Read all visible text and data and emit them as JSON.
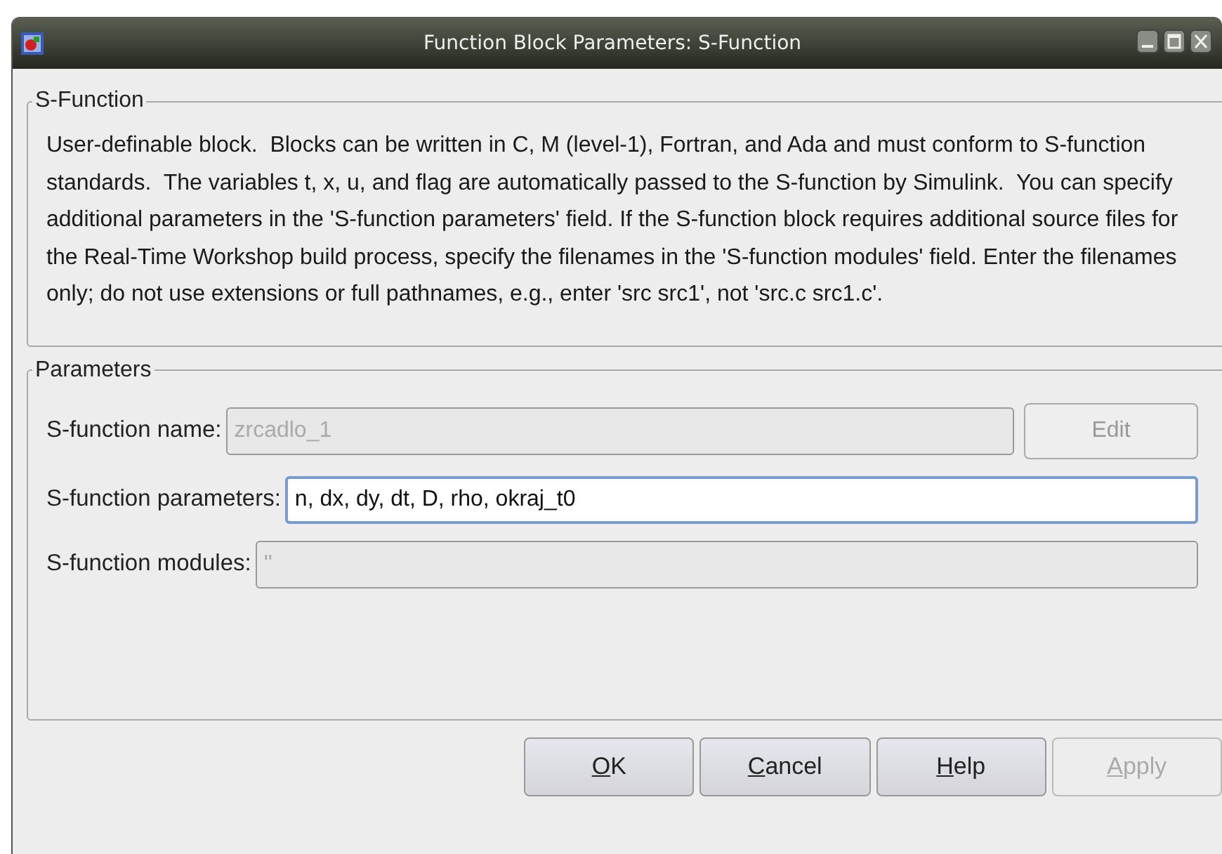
{
  "window": {
    "title": "Function Block Parameters: S-Function"
  },
  "description": {
    "legend": "S-Function",
    "text": "User-definable block.  Blocks can be written in C, M (level-1), Fortran, and Ada and must conform to S-function standards.  The variables t, x, u, and flag are automatically passed to the S-function by Simulink.  You can specify additional parameters in the 'S-function parameters' field. If the S-function block requires additional source files for the Real-Time Workshop build process, specify the filenames in the 'S-function modules' field. Enter the filenames only; do not use extensions or full pathnames, e.g., enter 'src src1', not 'src.c src1.c'."
  },
  "parameters": {
    "legend": "Parameters",
    "fields": [
      {
        "label": "S-function name:",
        "value": "zrcadlo_1",
        "disabled": true,
        "button": {
          "label": "Edit",
          "disabled": true
        }
      },
      {
        "label": "S-function parameters:",
        "value": "n, dx, dy, dt, D, rho, okraj_t0",
        "disabled": false
      },
      {
        "label": "S-function modules:",
        "value": "''",
        "disabled": true
      }
    ]
  },
  "buttons": [
    {
      "label": "OK",
      "disabled": false
    },
    {
      "label": "Cancel",
      "disabled": false
    },
    {
      "label": "Help",
      "disabled": false
    },
    {
      "label": "Apply",
      "disabled": true
    }
  ]
}
